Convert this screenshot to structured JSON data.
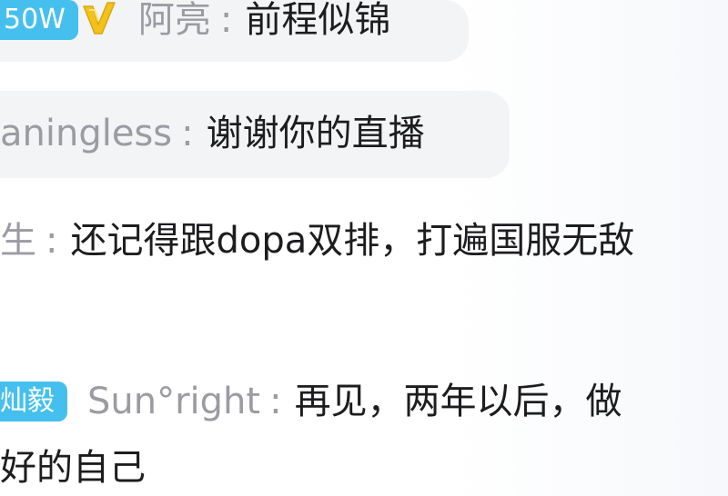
{
  "comments": [
    {
      "level_badge": "50W",
      "vip_icon": "v-icon",
      "username": "阿亮",
      "separator": ":",
      "message": "前程似锦"
    },
    {
      "username": "aningless",
      "separator": ":",
      "message": "谢谢你的直播"
    },
    {
      "username": "生",
      "separator": ":",
      "message": "还记得跟dopa双排，打遍国服无敌"
    },
    {
      "fan_badge": "灿毅",
      "username": "Sun°right",
      "separator": ":",
      "message": "再见，两年以后，做",
      "message_continued": "好的自己"
    }
  ],
  "colors": {
    "badge_bg": "#45c0ee",
    "badge_text": "#ffffff",
    "username": "#9b9ba2",
    "message": "#1d1d1f",
    "vip_icon": "#f2c21b",
    "bubble_bg": "#f3f4f6"
  }
}
